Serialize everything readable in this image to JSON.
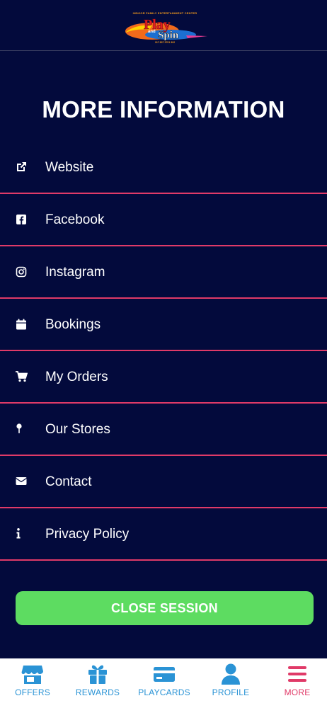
{
  "header": {
    "logo": {
      "tagline": "INDOOR FAMILY ENTERTAINMENT CENTER",
      "word1": "Play",
      "word2": "and",
      "word3": "Spin",
      "phone": "317 837 3701 302"
    }
  },
  "page": {
    "title": "MORE INFORMATION"
  },
  "menu": {
    "items": [
      {
        "label": "Website",
        "icon": "external-link-icon"
      },
      {
        "label": "Facebook",
        "icon": "facebook-icon"
      },
      {
        "label": "Instagram",
        "icon": "instagram-icon"
      },
      {
        "label": "Bookings",
        "icon": "calendar-icon"
      },
      {
        "label": "My Orders",
        "icon": "cart-icon"
      },
      {
        "label": "Our Stores",
        "icon": "map-pin-icon"
      },
      {
        "label": "Contact",
        "icon": "envelope-icon"
      },
      {
        "label": "Privacy Policy",
        "icon": "info-icon"
      }
    ]
  },
  "actions": {
    "close_session": "CLOSE SESSION"
  },
  "tabbar": {
    "tabs": [
      {
        "label": "OFFERS",
        "icon": "store-icon"
      },
      {
        "label": "REWARDS",
        "icon": "gift-icon"
      },
      {
        "label": "PLAYCARDS",
        "icon": "credit-card-icon"
      },
      {
        "label": "PROFILE",
        "icon": "user-icon"
      },
      {
        "label": "MORE",
        "icon": "menu-icon",
        "active": true
      }
    ]
  },
  "colors": {
    "background": "#030a3c",
    "divider": "#e03a68",
    "button": "#5ddc61",
    "tab_inactive": "#2a93d5",
    "tab_active": "#e03a68"
  }
}
